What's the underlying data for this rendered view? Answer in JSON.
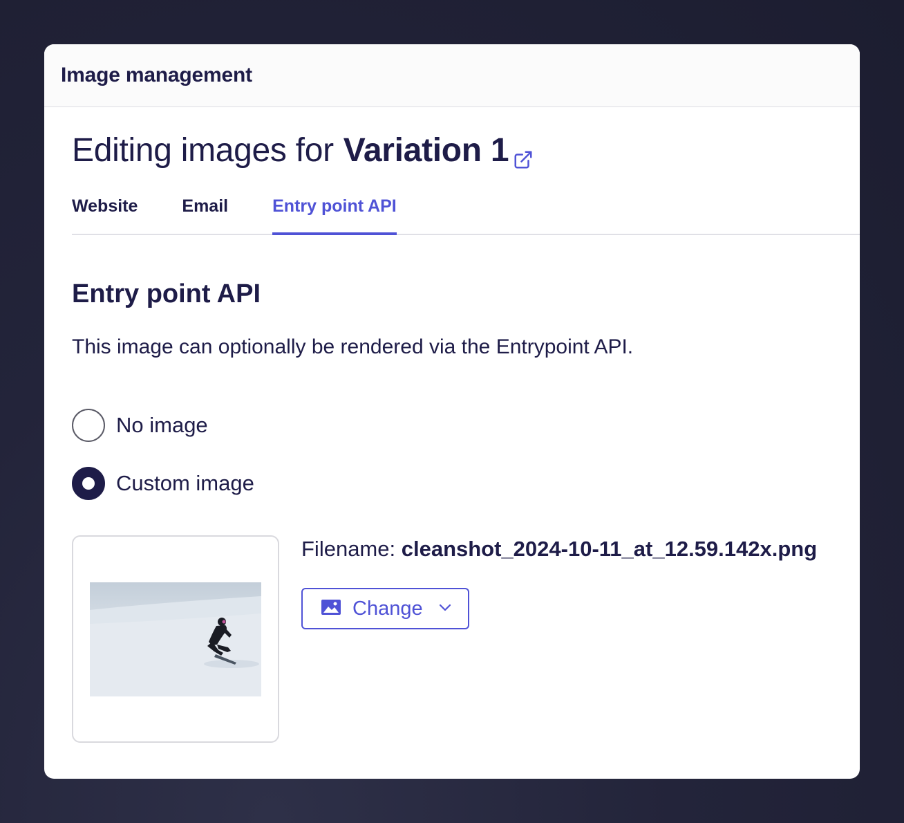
{
  "modal": {
    "header_title": "Image management"
  },
  "page": {
    "heading_prefix": "Editing images for",
    "heading_variation": "Variation 1",
    "heading_icon": "external-link-icon"
  },
  "tabs": [
    {
      "label": "Website",
      "active": false
    },
    {
      "label": "Email",
      "active": false
    },
    {
      "label": "Entry point API",
      "active": true
    }
  ],
  "section": {
    "title": "Entry point API",
    "description": "This image can optionally be rendered via the Entrypoint API."
  },
  "options": [
    {
      "label": "No image",
      "checked": false
    },
    {
      "label": "Custom image",
      "checked": true
    }
  ],
  "image": {
    "filename_label": "Filename:",
    "filename_value": "cleanshot_2024-10-11_at_12.59.142x.png",
    "change_label": "Change",
    "change_icon": "image-icon",
    "change_dropdown_icon": "chevron-down-icon"
  },
  "colors": {
    "accent": "#4f52d6",
    "text": "#1e1c48",
    "background": "#23243a"
  }
}
